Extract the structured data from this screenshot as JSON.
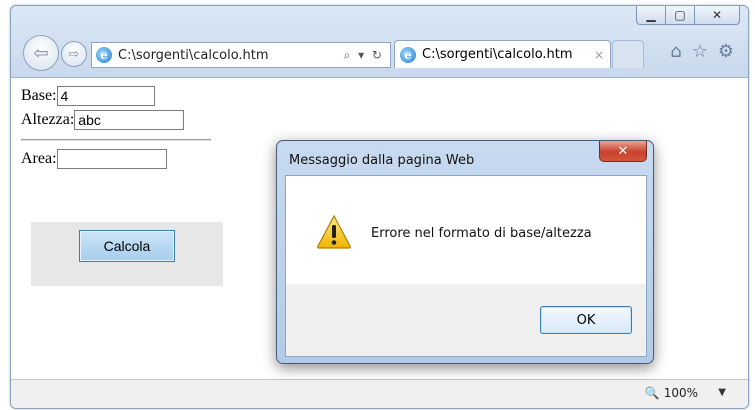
{
  "window": {
    "controls": {
      "minimize": "▁",
      "maximize": "▢",
      "close": "✕"
    }
  },
  "nav": {
    "back_icon": "arrow-left",
    "forward_icon": "arrow-right"
  },
  "address": {
    "url": "C:\\sorgenti\\calcolo.htm",
    "tools": "⌕ ▾ ↻"
  },
  "tab": {
    "title": "C:\\sorgenti\\calcolo.htm",
    "close": "×"
  },
  "toolbar": {
    "icons": [
      "home-icon",
      "star-icon",
      "gear-icon"
    ]
  },
  "form": {
    "base_label": "Base:",
    "base_value": "4",
    "altezza_label": "Altezza:",
    "altezza_value": "abc",
    "area_label": "Area:",
    "area_value": "",
    "calc_button": "Calcola"
  },
  "statusbar": {
    "zoom": "100%"
  },
  "dialog": {
    "title": "Messaggio dalla pagina Web",
    "close": "✕",
    "message": "Errore nel formato di base/altezza",
    "ok_button": "OK",
    "icon": "warning-icon"
  },
  "colors": {
    "chrome": "#c9d9ec",
    "dialog_close": "#c7412b",
    "button_panel": "#e7e7e7",
    "calc_button": "#a5cdee"
  }
}
